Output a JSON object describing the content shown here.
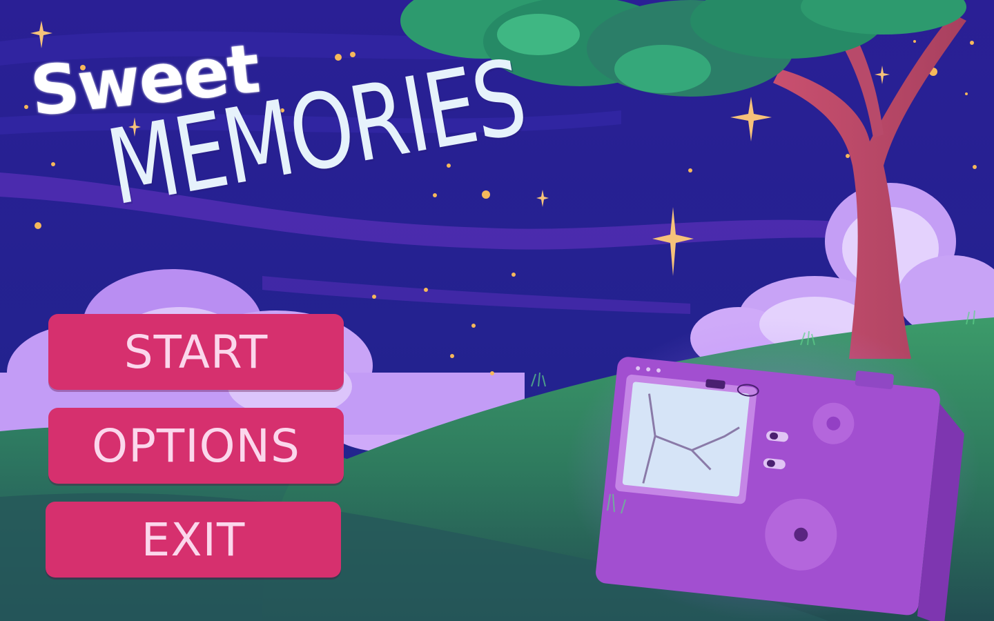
{
  "game": {
    "title_line1": "Sweet",
    "title_line2": "MEMORIES"
  },
  "menu": {
    "items": [
      {
        "label": "START"
      },
      {
        "label": "OPTIONS"
      },
      {
        "label": "EXIT"
      }
    ]
  },
  "colors": {
    "sky": "#231f8e",
    "button": "#d6306e",
    "button_text": "#fbd7ec",
    "title": "#e6f2fb",
    "grass": "#2e8a5e",
    "camera": "#a24fd0"
  },
  "icons": [
    "star-icon",
    "sparkle-icon",
    "cloud-icon",
    "tree-icon",
    "camera-icon"
  ]
}
